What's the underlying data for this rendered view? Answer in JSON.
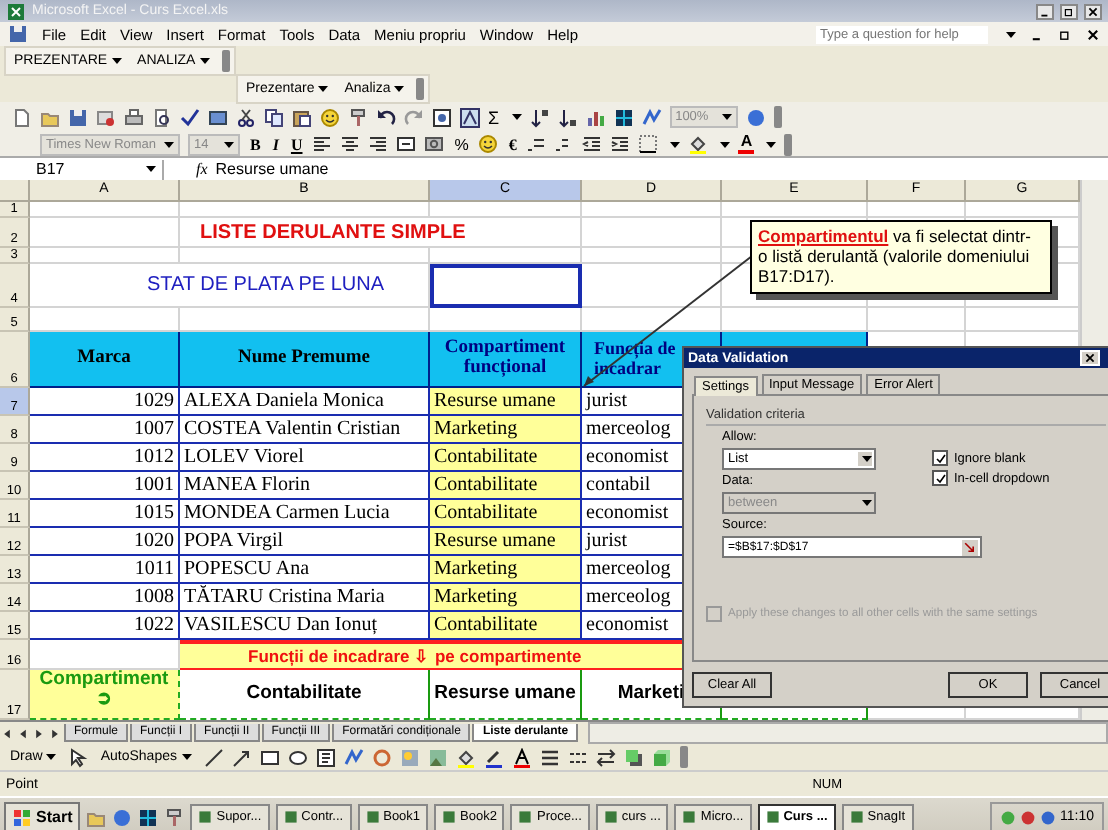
{
  "window": {
    "title": "Microsoft Excel - Curs Excel.xls"
  },
  "menu_bar": {
    "items": [
      "File",
      "Edit",
      "View",
      "Insert",
      "Format",
      "Tools",
      "Data",
      "Meniu propriu",
      "Window",
      "Help"
    ],
    "help_placeholder": "Type a question for help"
  },
  "custom_toolbars": [
    {
      "items": [
        "PREZENTARE",
        "ANALIZA"
      ]
    },
    {
      "items": [
        "Prezentare",
        "Analiza"
      ]
    }
  ],
  "standard_toolbar": {
    "autosum": "Σ",
    "zoom": "100%"
  },
  "formatting_toolbar": {
    "font": "Times New Roman",
    "size": "14",
    "bold": "B",
    "italic": "I",
    "underline": "U",
    "percent": "%",
    "euro": "€",
    "font_color": "A"
  },
  "formula_bar": {
    "name_box": "B17",
    "fx": "fx",
    "value": "Resurse umane"
  },
  "columns": [
    {
      "label": "A",
      "selected": false
    },
    {
      "label": "B",
      "selected": false
    },
    {
      "label": "C",
      "selected": true
    },
    {
      "label": "D",
      "selected": false
    },
    {
      "label": "E",
      "selected": false
    },
    {
      "label": "F",
      "selected": false
    },
    {
      "label": "G",
      "selected": false
    }
  ],
  "row_numbers": [
    {
      "label": "1",
      "selected": false
    },
    {
      "label": "2",
      "selected": false
    },
    {
      "label": "3",
      "selected": false
    },
    {
      "label": "4",
      "selected": false
    },
    {
      "label": "5",
      "selected": false
    },
    {
      "label": "6",
      "selected": false
    },
    {
      "label": "7",
      "selected": true
    },
    {
      "label": "8",
      "selected": false
    },
    {
      "label": "9",
      "selected": false
    },
    {
      "label": "10",
      "selected": false
    },
    {
      "label": "11",
      "selected": false
    },
    {
      "label": "12",
      "selected": false
    },
    {
      "label": "13",
      "selected": false
    },
    {
      "label": "14",
      "selected": false
    },
    {
      "label": "15",
      "selected": false
    },
    {
      "label": "16",
      "selected": false
    },
    {
      "label": "17",
      "selected": false
    }
  ],
  "sheet": {
    "title": "LISTE DERULANTE SIMPLE",
    "subtitle": "STAT DE PLATA PE LUNA",
    "table": {
      "columns": [
        "Marca",
        "Nume Premume",
        "Compartiment funcțional",
        "Funcția de incadrar"
      ],
      "rows": [
        {
          "marca": "1029",
          "name": "ALEXA Daniela Monica",
          "department": "Resurse umane",
          "job": "jurist"
        },
        {
          "marca": "1007",
          "name": "COSTEA Valentin Cristian",
          "department": "Marketing",
          "job": "merceolog"
        },
        {
          "marca": "1012",
          "name": "LOLEV Viorel",
          "department": "Contabilitate",
          "job": "economist"
        },
        {
          "marca": "1001",
          "name": "MANEA Florin",
          "department": "Contabilitate",
          "job": "contabil"
        },
        {
          "marca": "1015",
          "name": "MONDEA Carmen Lucia",
          "department": "Contabilitate",
          "job": "economist"
        },
        {
          "marca": "1020",
          "name": "POPA Virgil",
          "department": "Resurse umane",
          "job": "jurist"
        },
        {
          "marca": "1011",
          "name": "POPESCU Ana",
          "department": "Marketing",
          "job": "merceolog"
        },
        {
          "marca": "1008",
          "name": "TĂTARU Cristina Maria",
          "department": "Marketing",
          "job": "merceolog"
        },
        {
          "marca": "1022",
          "name": "VASILESCU Dan Ionuț",
          "department": "Contabilitate",
          "job": "economist"
        }
      ]
    },
    "banner": "Funcții de incadrare ⇩ pe compartimente",
    "lookup_label": "Compartiment ➲",
    "lookup_values": [
      "Contabilitate",
      "Resurse umane",
      "Marketi"
    ]
  },
  "callout": "**Compartimentul** va fi selectat dintr-o listă derulantă (valorile domeniului B17:D17).",
  "dialog": {
    "title": "Data Validation",
    "tabs": [
      {
        "label": "Settings",
        "selected": true
      },
      {
        "label": "Input Message",
        "selected": false
      },
      {
        "label": "Error Alert",
        "selected": false
      }
    ],
    "group_label": "Validation criteria",
    "allow": {
      "label": "Allow:",
      "value": "List"
    },
    "data": {
      "label": "Data:",
      "value": "between",
      "disabled": true
    },
    "options": [
      {
        "label": "Ignore blank",
        "checked": true
      },
      {
        "label": "In-cell dropdown",
        "checked": true
      }
    ],
    "source": {
      "label": "Source:",
      "value": "=$B$17:$D$17"
    },
    "apply": {
      "label": "Apply these changes to all other cells with the same settings",
      "checked": false,
      "disabled": true
    },
    "buttons": [
      "Clear All",
      "OK",
      "Cancel"
    ]
  },
  "sheet_tabs": [
    {
      "label": "Formule",
      "selected": false
    },
    {
      "label": "Funcții I",
      "selected": false
    },
    {
      "label": "Funcții II",
      "selected": false
    },
    {
      "label": "Funcții III",
      "selected": false
    },
    {
      "label": "Formatări condiționale",
      "selected": false
    },
    {
      "label": "Liste derulante",
      "selected": true
    }
  ],
  "drawing_toolbar": {
    "draw": "Draw",
    "autoshapes": "AutoShapes"
  },
  "status_bar": {
    "mode": "Point",
    "num": "NUM"
  },
  "taskbar": {
    "start": "Start",
    "items": [
      {
        "label": "Supor...",
        "selected": false
      },
      {
        "label": "Contr...",
        "selected": false
      },
      {
        "label": "Book1",
        "selected": false
      },
      {
        "label": "Book2",
        "selected": false
      },
      {
        "label": "Proce...",
        "selected": false
      },
      {
        "label": "curs ...",
        "selected": false
      },
      {
        "label": "Micro...",
        "selected": false
      },
      {
        "label": "Curs ...",
        "selected": true
      },
      {
        "label": "SnagIt",
        "selected": false
      }
    ],
    "clock": "11:10"
  }
}
